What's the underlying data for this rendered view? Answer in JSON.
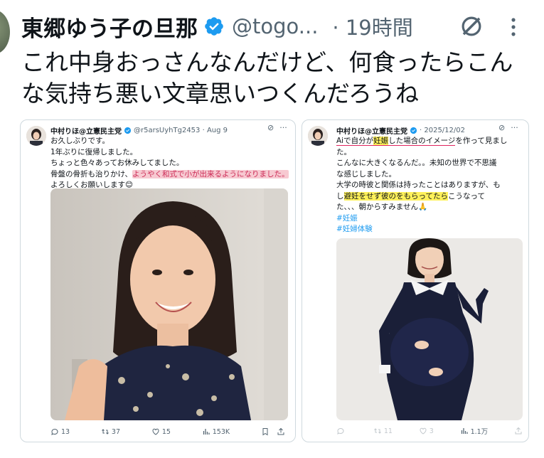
{
  "header": {
    "display_name": "東郷ゆう子の旦那",
    "handle": "@togo...",
    "time": "· 19時間"
  },
  "tweet": {
    "line1": "これ中身おっさんなんだけど、何食ったらこん",
    "line2": "な気持ち悪い文章思いつくんだろうね"
  },
  "card1": {
    "name": "中村りほ@立憲民主党",
    "handle_date": "@r5arsUyhTg2453 · Aug 9",
    "lines": [
      "お久しぶりです。",
      "1年ぶりに復帰しました。",
      "ちょっと色々あってお休みしてました。"
    ],
    "line4_pre": "骨盤の骨折も治りかけ、",
    "line4_highlight": "ようやく和式で小が出来るようになりました。",
    "line5": "よろしくお願いします",
    "line5_emoji": "😊",
    "actions": {
      "replies": "13",
      "retweets": "37",
      "likes": "15",
      "views": "153K"
    }
  },
  "card2": {
    "name": "中村りほ@立憲民主党",
    "date": "· 2025/12/02",
    "line1_a": "Aiで自分が",
    "line1_b": "妊娠",
    "line1_c": "した場合のイメージ",
    "line1_d": "を作って見まし",
    "line2": "た。",
    "line3": "こんなに大きくなるんだ。。未知の世界で不思議",
    "line4": "な感じしました。",
    "line5": "大学の時彼と関係は持ったことはありますが、も",
    "line6_pre": "し",
    "line6_highlight": "避妊をせず彼のをもらってたら",
    "line6_post": "こうなって",
    "line7": "た、、、朝からすみません",
    "line7_emoji": "🙏",
    "tag1": "#妊娠",
    "tag2": "#妊婦体験",
    "actions": {
      "replies": "",
      "retweets": "11",
      "likes": "3",
      "views": "1.1万"
    }
  },
  "colors": {
    "verified": "#1d9bf0",
    "muted": "#536471",
    "accent_pink": "#f7c9d1",
    "accent_yellow": "#fff15a"
  }
}
